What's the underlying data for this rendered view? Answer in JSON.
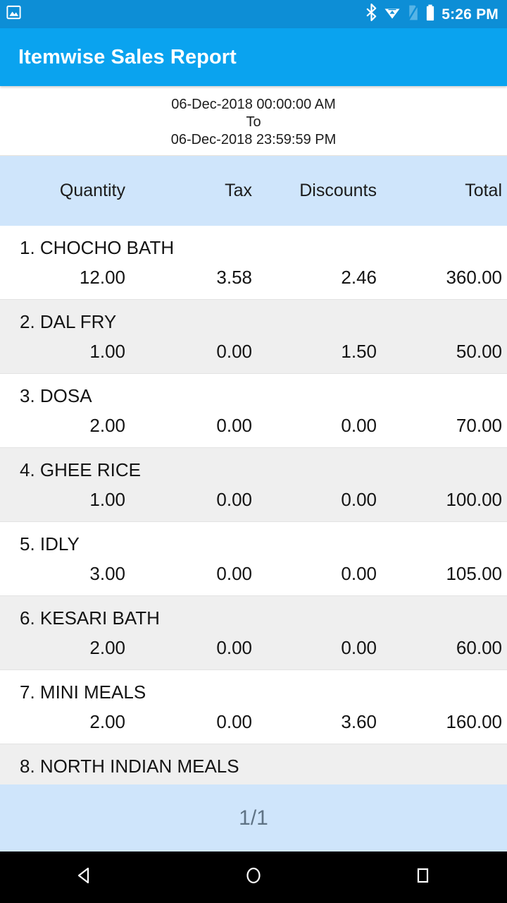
{
  "statusbar": {
    "notification_icon": "image-icon",
    "icons": [
      "bluetooth-icon",
      "wifi-icon",
      "sim-card-icon",
      "battery-icon"
    ],
    "time": "5:26 PM"
  },
  "appbar": {
    "title": "Itemwise Sales Report"
  },
  "daterange": {
    "from": "06-Dec-2018 00:00:00 AM",
    "separator": "To",
    "to": "06-Dec-2018 23:59:59 PM"
  },
  "table": {
    "headers": {
      "quantity": "Quantity",
      "tax": "Tax",
      "discounts": "Discounts",
      "total": "Total"
    },
    "rows": [
      {
        "name": "1. CHOCHO BATH",
        "quantity": "12.00",
        "tax": "3.58",
        "discounts": "2.46",
        "total": "360.00"
      },
      {
        "name": "2. DAL FRY",
        "quantity": "1.00",
        "tax": "0.00",
        "discounts": "1.50",
        "total": "50.00"
      },
      {
        "name": "3. DOSA",
        "quantity": "2.00",
        "tax": "0.00",
        "discounts": "0.00",
        "total": "70.00"
      },
      {
        "name": "4. GHEE RICE",
        "quantity": "1.00",
        "tax": "0.00",
        "discounts": "0.00",
        "total": "100.00"
      },
      {
        "name": "5. IDLY",
        "quantity": "3.00",
        "tax": "0.00",
        "discounts": "0.00",
        "total": "105.00"
      },
      {
        "name": "6. KESARI BATH",
        "quantity": "2.00",
        "tax": "0.00",
        "discounts": "0.00",
        "total": "60.00"
      },
      {
        "name": "7. MINI MEALS",
        "quantity": "2.00",
        "tax": "0.00",
        "discounts": "3.60",
        "total": "160.00"
      },
      {
        "name": "8. NORTH INDIAN MEALS",
        "quantity": "",
        "tax": "",
        "discounts": "",
        "total": ""
      }
    ]
  },
  "pager": {
    "label": "1/1"
  },
  "navbar": {
    "back": "back-icon",
    "home": "home-icon",
    "recents": "recents-icon"
  },
  "colors": {
    "statusbar": "#0d8ed6",
    "appbar": "#0aa3ef",
    "header_band": "#cfe5fb",
    "row_alt": "#efefef",
    "pager_text": "#5f7385"
  }
}
